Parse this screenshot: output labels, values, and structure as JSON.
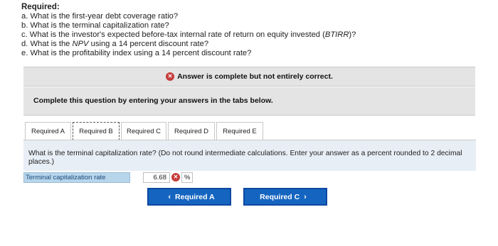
{
  "required": {
    "title": "Required:",
    "items": [
      "a. What is the first-year debt coverage ratio?",
      "b. What is the terminal capitalization rate?",
      "c. What is the investor's expected before-tax internal rate of return on equity invested (BTIRR)?",
      "d. What is the NPV using a 14 percent discount rate?",
      "e. What is the profitability index using a 14 percent discount rate?"
    ]
  },
  "status": {
    "text": "Answer is complete but not entirely correct.",
    "icon": "x-circle-icon",
    "color": "#c63c3c"
  },
  "instruction": "Complete this question by entering your answers in the tabs below.",
  "tabs": [
    {
      "label": "Required A"
    },
    {
      "label": "Required B",
      "active": true
    },
    {
      "label": "Required C"
    },
    {
      "label": "Required D"
    },
    {
      "label": "Required E"
    }
  ],
  "question": "What is the terminal capitalization rate? (Do not round intermediate calculations. Enter your answer as a percent rounded to 2 decimal places.)",
  "answer": {
    "label": "Terminal capitalization rate",
    "value": "6.68",
    "unit": "%"
  },
  "nav": {
    "prev_label": "Required A",
    "next_label": "Required C",
    "accent": "#1565c0"
  }
}
